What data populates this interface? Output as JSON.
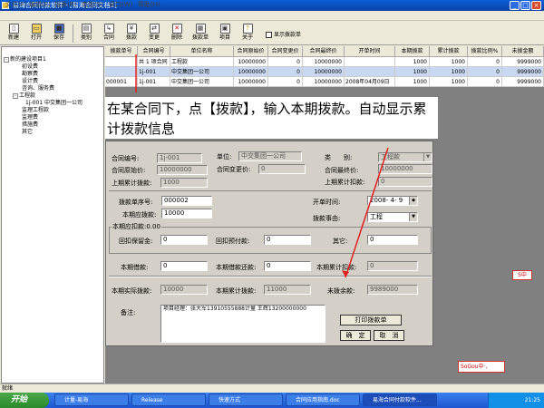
{
  "window": {
    "title": "易海合同付款软件 - [易海合同文档1]"
  },
  "menu": [
    "文件(F)",
    "编辑(E)",
    "报表(R)",
    "查询(S)",
    "窗口(W)",
    "帮助(H)"
  ],
  "toolbar": {
    "items": [
      {
        "label": "新建",
        "icon": "new-icon"
      },
      {
        "label": "打开",
        "icon": "open-icon"
      },
      {
        "label": "保存",
        "icon": "save-icon"
      },
      {
        "label": "类别",
        "icon": "category-icon"
      },
      {
        "label": "合同",
        "icon": "contract-icon"
      },
      {
        "label": "拨款",
        "icon": "payment-icon"
      },
      {
        "label": "变更",
        "icon": "change-icon"
      },
      {
        "label": "删除",
        "icon": "delete-icon"
      },
      {
        "label": "拨款单",
        "icon": "print-icon"
      },
      {
        "label": "项目",
        "icon": "project-icon"
      },
      {
        "label": "关于",
        "icon": "about-icon"
      }
    ],
    "show_checkbox_label": "显示拨款单"
  },
  "tree": [
    {
      "label": "新的建设项目1",
      "level": 0,
      "box": "-"
    },
    {
      "label": "初设费",
      "level": 1
    },
    {
      "label": "勘察费",
      "level": 1
    },
    {
      "label": "设计费",
      "level": 1
    },
    {
      "label": "咨询、服务费",
      "level": 1
    },
    {
      "label": "工程款",
      "level": 1,
      "box": "-"
    },
    {
      "label": "1j-001 中交集团一公司",
      "level": 2
    },
    {
      "label": "监理工程款",
      "level": 1
    },
    {
      "label": "监理费",
      "level": 1
    },
    {
      "label": "措施费",
      "level": 1
    },
    {
      "label": "其它",
      "level": 1
    }
  ],
  "grid": {
    "headers": [
      "拨款单号",
      "合同编号",
      "单位名称",
      "合同原始价",
      "合同变更价",
      "合同最终价",
      "开单时间",
      "本期拨款",
      "累计拨款",
      "拨款比例%",
      "未拨金额"
    ],
    "rows": [
      [
        "",
        "共 1 项合同",
        "工程款",
        "10000000",
        "0",
        "10000000",
        "",
        "1000",
        "1000",
        "0",
        "9999000"
      ],
      [
        "",
        "1j-001",
        "中交集团一公司",
        "10000000",
        "0",
        "10000000",
        "",
        "1000",
        "1000",
        "0",
        "9999000"
      ],
      [
        "000001",
        "1j-001",
        "中交集团一公司",
        "10000000",
        "0",
        "10000000",
        "2008年04月09日",
        "1000",
        "1000",
        "0",
        "9999000"
      ]
    ]
  },
  "caption": "在某合同下，点【拨款】，输入本期拨款。自动显示累计拨款信息",
  "dialog": {
    "contract_no_label": "合同编号:",
    "contract_no": "1j-001",
    "unit_label": "单位:",
    "unit": "中交集团一公司",
    "category_label": "类　　别:",
    "category": "工程款",
    "orig_price_label": "合同原始价:",
    "orig_price": "10000000",
    "change_price_label": "合同变更价:",
    "change_price": "0",
    "final_price_label": "合同最终价:",
    "final_price": "10000000",
    "prev_cum_pay_label": "上期累计拨款:",
    "prev_cum_pay": "1000",
    "prev_cum_deduct_label": "上期累计扣款:",
    "prev_cum_deduct": "0",
    "pay_no_label": "拨款单序号:",
    "pay_no": "000002",
    "current_pay_label": "本期应拨款:",
    "current_pay": "10000",
    "open_time_label": "开单时间:",
    "open_time": "2008- 4- 9",
    "reason_label": "拨款事由:",
    "reason": "工程",
    "deduct_group_label": "本期应扣款:0.00",
    "retention_label": "回扣保留金:",
    "retention": "0",
    "advance_label": "回扣预付款:",
    "advance": "0",
    "other_label": "其它:",
    "other": "0",
    "cur_deduct_label": "本期借款:",
    "cur_deduct": "0",
    "cur_return_label": "本期借款还款:",
    "cur_return": "0",
    "cum_deduct_label": "本期累计扣款:",
    "cum_deduct": "0",
    "actual_pay_label": "本期实际拨款:",
    "actual_pay": "10000",
    "cum_pay_label": "本期累计拨款:",
    "cum_pay": "11000",
    "unpaid_label": "未拨余款:",
    "unpaid": "9989000",
    "remark_label": "备注:",
    "remark": "项目经理：张大军13910555888计量 王辉13200000000",
    "print_button": "打印拨款单",
    "ok_button": "确　定",
    "cancel_button": "取　消"
  },
  "statusbar": "就绪",
  "taskbar": {
    "start": "开始",
    "tasks": [
      "计量-易海",
      "Release",
      "快速方式",
      "合同应用指南.doc",
      "易海合同付款软件..."
    ],
    "clock": "21:25"
  },
  "ime": {
    "sogou": "SoGou中·,",
    "side": "S中"
  },
  "colors": {
    "title_bar": "#0842a8",
    "selected_row": "#c8d8f0",
    "annotation_red": "#e02020"
  }
}
